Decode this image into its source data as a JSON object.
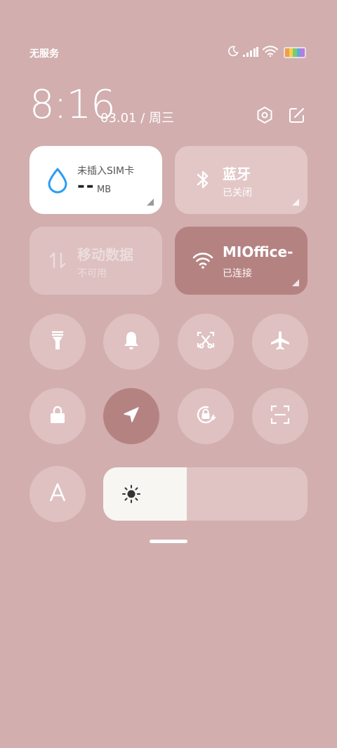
{
  "status_bar": {
    "carrier": "无服务",
    "battery_colors": [
      "#f29d4b",
      "#f5d34e",
      "#7ecb6a",
      "#5aa9e6",
      "#b77ce0"
    ]
  },
  "clock": {
    "time": "8:16",
    "date": "03.01 / 周三"
  },
  "header_icons": [
    "settings-icon",
    "edit-icon"
  ],
  "tiles": {
    "data_usage": {
      "title": "未插入SIM卡",
      "value": "--",
      "unit": "MB",
      "accent": "#2a9df4"
    },
    "bluetooth": {
      "title": "蓝牙",
      "subtitle": "已关闭"
    },
    "mobile_data": {
      "title": "移动数据",
      "subtitle": "不可用"
    },
    "wifi": {
      "title": "MIOffice-",
      "subtitle": "已连接",
      "color": "#b58282"
    }
  },
  "toggles": [
    {
      "icon": "flashlight-icon",
      "active": false
    },
    {
      "icon": "bell-icon",
      "active": false
    },
    {
      "icon": "screenshot-icon",
      "active": false
    },
    {
      "icon": "airplane-icon",
      "active": false
    },
    {
      "icon": "lock-icon",
      "active": false
    },
    {
      "icon": "location-icon",
      "active": true
    },
    {
      "icon": "rotation-lock-icon",
      "active": false
    },
    {
      "icon": "scan-icon",
      "active": false
    },
    {
      "icon": "font-icon",
      "active": false
    }
  ],
  "brightness": {
    "level": 0.41,
    "icon": "sun-icon"
  },
  "colors": {
    "background": "#d2aeae",
    "active_toggle": "#b58282"
  }
}
